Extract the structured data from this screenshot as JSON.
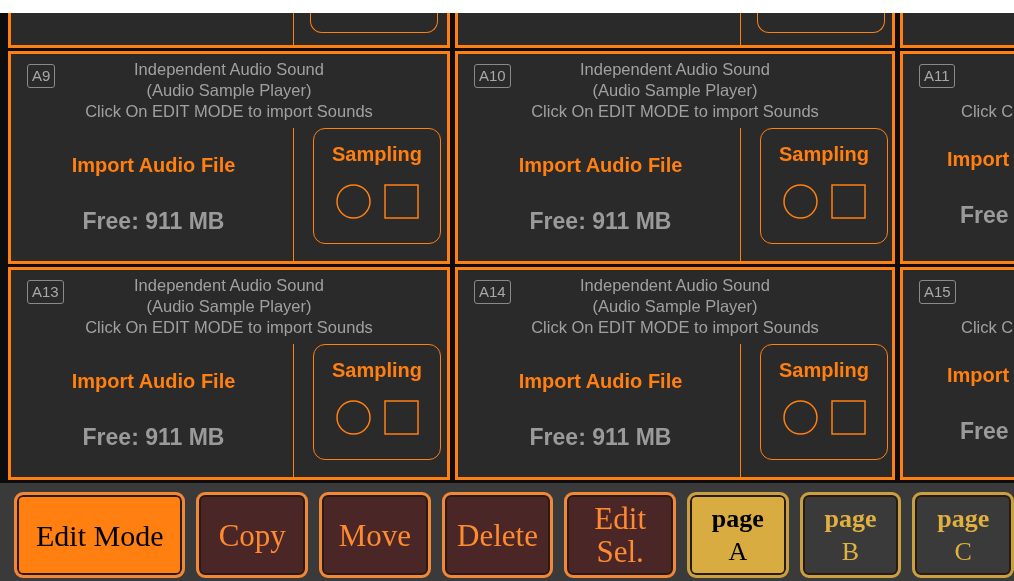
{
  "pad_rows": [
    [
      {
        "kind": "full",
        "id": "A9",
        "description": [
          "Independent Audio Sound",
          "(Audio Sample Player)",
          "Click On EDIT MODE to import Sounds"
        ],
        "import_label": "Import Audio File",
        "free": "Free: 911 MB",
        "sampling_label": "Sampling"
      },
      {
        "kind": "full",
        "id": "A10",
        "description": [
          "Independent Audio Sound",
          "(Audio Sample Player)",
          "Click On EDIT MODE to import Sounds"
        ],
        "import_label": "Import Audio File",
        "free": "Free: 911 MB",
        "sampling_label": "Sampling"
      },
      {
        "kind": "cut",
        "id": "A11",
        "description": [
          "Click C"
        ],
        "import_label": "Import",
        "free": "Free"
      }
    ],
    [
      {
        "kind": "full",
        "id": "A13",
        "description": [
          "Independent Audio Sound",
          "(Audio Sample Player)",
          "Click On EDIT MODE to import Sounds"
        ],
        "import_label": "Import Audio File",
        "free": "Free: 911 MB",
        "sampling_label": "Sampling"
      },
      {
        "kind": "full",
        "id": "A14",
        "description": [
          "Independent Audio Sound",
          "(Audio Sample Player)",
          "Click On EDIT MODE to import Sounds"
        ],
        "import_label": "Import Audio File",
        "free": "Free: 911 MB",
        "sampling_label": "Sampling"
      },
      {
        "kind": "cut",
        "id": "A15",
        "description": [
          "Click C"
        ],
        "import_label": "Import",
        "free": "Free"
      }
    ]
  ],
  "toolbar": [
    {
      "kind": "action",
      "label": [
        "Edit Mode"
      ],
      "on": true
    },
    {
      "kind": "action",
      "label": [
        "Copy"
      ],
      "on": false
    },
    {
      "kind": "action",
      "label": [
        "Move"
      ],
      "on": false
    },
    {
      "kind": "action",
      "label": [
        "Delete"
      ],
      "on": false
    },
    {
      "kind": "action",
      "label": [
        "Edit",
        "Sel."
      ],
      "on": false
    },
    {
      "kind": "page",
      "label": [
        "page",
        "A"
      ],
      "selected": true
    },
    {
      "kind": "page",
      "label": [
        "page",
        "B"
      ],
      "selected": false
    },
    {
      "kind": "page",
      "label": [
        "page",
        "C"
      ],
      "selected": false
    }
  ]
}
